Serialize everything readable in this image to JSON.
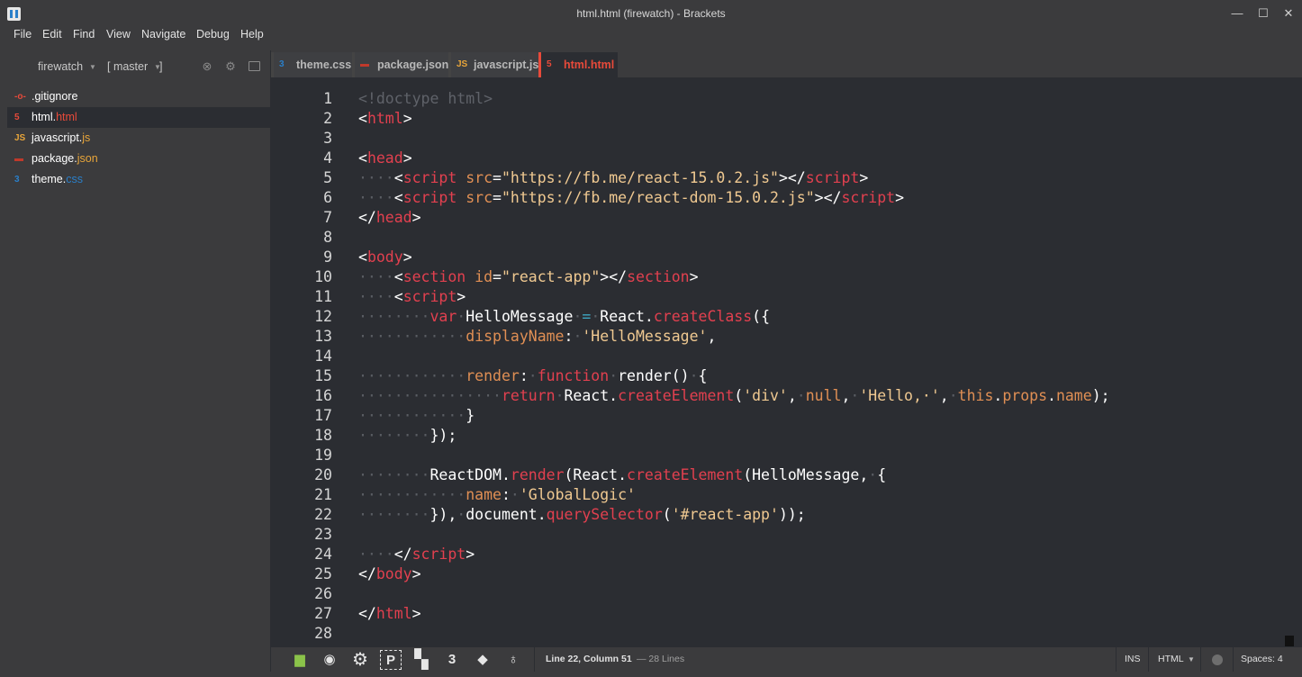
{
  "window": {
    "title": "html.html (firewatch) - Brackets",
    "minimize": "—",
    "maximize": "☐",
    "close": "✕"
  },
  "menu": [
    "File",
    "Edit",
    "Find",
    "View",
    "Navigate",
    "Debug",
    "Help"
  ],
  "sidebar": {
    "project": "firewatch",
    "branch": "[ master",
    "branch_close": "]",
    "files": [
      {
        "icon": "-o-",
        "icon_color": "#e84a3a",
        "name": ".gitignore",
        "ext": ""
      },
      {
        "icon": "5",
        "icon_color": "#e84a3a",
        "name": "html.",
        "ext": "html",
        "ext_color": "#e84a3a",
        "selected": true
      },
      {
        "icon": "JS",
        "icon_color": "#e8a53a",
        "name": "javascript.",
        "ext": "js",
        "ext_color": "#e8a53a"
      },
      {
        "icon": "▬",
        "icon_color": "#c0392b",
        "name": "package.",
        "ext": "json",
        "ext_color": "#e8a53a"
      },
      {
        "icon": "3",
        "icon_color": "#2a7fc9",
        "name": "theme.",
        "ext": "css",
        "ext_color": "#2a7fc9"
      }
    ]
  },
  "tabs": [
    {
      "icon": "3",
      "icon_color": "#2a7fc9",
      "label": "theme.css",
      "active": false
    },
    {
      "icon": "▬",
      "icon_color": "#c0392b",
      "label": "package.json",
      "active": false
    },
    {
      "icon": "JS",
      "icon_color": "#e8a53a",
      "label": "javascript.js",
      "active": false
    },
    {
      "icon": "5",
      "icon_color": "#e84a3a",
      "label": "html.html",
      "active": true
    }
  ],
  "editor": {
    "line_numbers": [
      "1",
      "2",
      "3",
      "4",
      "5",
      "6",
      "7",
      "8",
      "9",
      "10",
      "11",
      "12",
      "13",
      "14",
      "15",
      "16",
      "17",
      "18",
      "19",
      "20",
      "21",
      "22",
      "23",
      "24",
      "25",
      "26",
      "27",
      "28"
    ],
    "lines": [
      [
        [
          "c-comment",
          "<!doctype html>"
        ]
      ],
      [
        [
          "c-punct",
          "<"
        ],
        [
          "c-tag",
          "html"
        ],
        [
          "c-punct",
          ">"
        ]
      ],
      [],
      [
        [
          "c-punct",
          "<"
        ],
        [
          "c-tag",
          "head"
        ],
        [
          "c-punct",
          ">"
        ]
      ],
      [
        [
          "c-ws",
          "····"
        ],
        [
          "c-punct",
          "<"
        ],
        [
          "c-tag",
          "script"
        ],
        [
          "c-plain",
          " "
        ],
        [
          "c-attr",
          "src"
        ],
        [
          "c-punct",
          "="
        ],
        [
          "c-str",
          "\"https://fb.me/react-15.0.2.js\""
        ],
        [
          "c-punct",
          "></"
        ],
        [
          "c-tag",
          "script"
        ],
        [
          "c-punct",
          ">"
        ]
      ],
      [
        [
          "c-ws",
          "····"
        ],
        [
          "c-punct",
          "<"
        ],
        [
          "c-tag",
          "script"
        ],
        [
          "c-plain",
          " "
        ],
        [
          "c-attr",
          "src"
        ],
        [
          "c-punct",
          "="
        ],
        [
          "c-str",
          "\"https://fb.me/react-dom-15.0.2.js\""
        ],
        [
          "c-punct",
          "></"
        ],
        [
          "c-tag",
          "script"
        ],
        [
          "c-punct",
          ">"
        ]
      ],
      [
        [
          "c-punct",
          "</"
        ],
        [
          "c-tag",
          "head"
        ],
        [
          "c-punct",
          ">"
        ]
      ],
      [],
      [
        [
          "c-punct",
          "<"
        ],
        [
          "c-tag",
          "body"
        ],
        [
          "c-punct",
          ">"
        ]
      ],
      [
        [
          "c-ws",
          "····"
        ],
        [
          "c-punct",
          "<"
        ],
        [
          "c-tag",
          "section"
        ],
        [
          "c-plain",
          " "
        ],
        [
          "c-attr",
          "id"
        ],
        [
          "c-punct",
          "="
        ],
        [
          "c-str",
          "\"react-app\""
        ],
        [
          "c-punct",
          "></"
        ],
        [
          "c-tag",
          "section"
        ],
        [
          "c-punct",
          ">"
        ]
      ],
      [
        [
          "c-ws",
          "····"
        ],
        [
          "c-punct",
          "<"
        ],
        [
          "c-tag",
          "script"
        ],
        [
          "c-punct",
          ">"
        ]
      ],
      [
        [
          "c-ws",
          "········"
        ],
        [
          "c-kw",
          "var"
        ],
        [
          "c-ws",
          "·"
        ],
        [
          "c-plain",
          "HelloMessage"
        ],
        [
          "c-ws",
          "·"
        ],
        [
          "c-op",
          "="
        ],
        [
          "c-ws",
          "·"
        ],
        [
          "c-plain",
          "React."
        ],
        [
          "c-fn",
          "createClass"
        ],
        [
          "c-plain",
          "({"
        ]
      ],
      [
        [
          "c-ws",
          "············"
        ],
        [
          "c-prop",
          "displayName"
        ],
        [
          "c-plain",
          ":"
        ],
        [
          "c-ws",
          "·"
        ],
        [
          "c-str",
          "'HelloMessage'"
        ],
        [
          "c-plain",
          ","
        ]
      ],
      [],
      [
        [
          "c-ws",
          "············"
        ],
        [
          "c-prop",
          "render"
        ],
        [
          "c-plain",
          ":"
        ],
        [
          "c-ws",
          "·"
        ],
        [
          "c-kw",
          "function"
        ],
        [
          "c-ws",
          "·"
        ],
        [
          "c-plain",
          "render()"
        ],
        [
          "c-ws",
          "·"
        ],
        [
          "c-plain",
          "{"
        ]
      ],
      [
        [
          "c-ws",
          "················"
        ],
        [
          "c-kw",
          "return"
        ],
        [
          "c-ws",
          "·"
        ],
        [
          "c-plain",
          "React."
        ],
        [
          "c-fn",
          "createElement"
        ],
        [
          "c-plain",
          "("
        ],
        [
          "c-str",
          "'div'"
        ],
        [
          "c-plain",
          ","
        ],
        [
          "c-ws",
          "·"
        ],
        [
          "c-attr",
          "null"
        ],
        [
          "c-plain",
          ","
        ],
        [
          "c-ws",
          "·"
        ],
        [
          "c-str",
          "'Hello,·'"
        ],
        [
          "c-plain",
          ","
        ],
        [
          "c-ws",
          "·"
        ],
        [
          "c-attr",
          "this"
        ],
        [
          "c-plain",
          "."
        ],
        [
          "c-prop",
          "props"
        ],
        [
          "c-plain",
          "."
        ],
        [
          "c-prop",
          "name"
        ],
        [
          "c-plain",
          ");"
        ]
      ],
      [
        [
          "c-ws",
          "············"
        ],
        [
          "c-plain",
          "}"
        ]
      ],
      [
        [
          "c-ws",
          "········"
        ],
        [
          "c-plain",
          "});"
        ]
      ],
      [],
      [
        [
          "c-ws",
          "········"
        ],
        [
          "c-plain",
          "ReactDOM."
        ],
        [
          "c-fn",
          "render"
        ],
        [
          "c-plain",
          "(React."
        ],
        [
          "c-fn",
          "createElement"
        ],
        [
          "c-plain",
          "(HelloMessage,"
        ],
        [
          "c-ws",
          "·"
        ],
        [
          "c-plain",
          "{"
        ]
      ],
      [
        [
          "c-ws",
          "············"
        ],
        [
          "c-prop",
          "name"
        ],
        [
          "c-plain",
          ":"
        ],
        [
          "c-ws",
          "·"
        ],
        [
          "c-str",
          "'GlobalLogic'"
        ]
      ],
      [
        [
          "c-ws",
          "········"
        ],
        [
          "c-plain",
          "}),"
        ],
        [
          "c-ws",
          "·"
        ],
        [
          "c-plain",
          "document."
        ],
        [
          "c-fn",
          "querySelector"
        ],
        [
          "c-plain",
          "("
        ],
        [
          "c-str",
          "'#react-app'"
        ],
        [
          "c-plain",
          "));"
        ]
      ],
      [],
      [
        [
          "c-ws",
          "····"
        ],
        [
          "c-punct",
          "</"
        ],
        [
          "c-tag",
          "script"
        ],
        [
          "c-punct",
          ">"
        ]
      ],
      [
        [
          "c-punct",
          "</"
        ],
        [
          "c-tag",
          "body"
        ],
        [
          "c-punct",
          ">"
        ]
      ],
      [],
      [
        [
          "c-punct",
          "</"
        ],
        [
          "c-tag",
          "html"
        ],
        [
          "c-punct",
          ">"
        ]
      ],
      []
    ]
  },
  "status": {
    "cursor": "Line 22, Column 51",
    "line_count": "— 28 Lines",
    "mode": "INS",
    "language": "HTML",
    "spaces": "Spaces: 4",
    "extensions": [
      {
        "name": "android-icon",
        "glyph": "▆"
      },
      {
        "name": "disk-icon",
        "glyph": "◉"
      },
      {
        "name": "gears-icon",
        "glyph": "⚙"
      },
      {
        "name": "p-icon",
        "glyph": "P"
      },
      {
        "name": "checker-icon",
        "glyph": "▚"
      },
      {
        "name": "css3-icon",
        "glyph": "3"
      },
      {
        "name": "git-icon",
        "glyph": "◆"
      },
      {
        "name": "lightbulb-icon",
        "glyph": "♁"
      }
    ]
  }
}
